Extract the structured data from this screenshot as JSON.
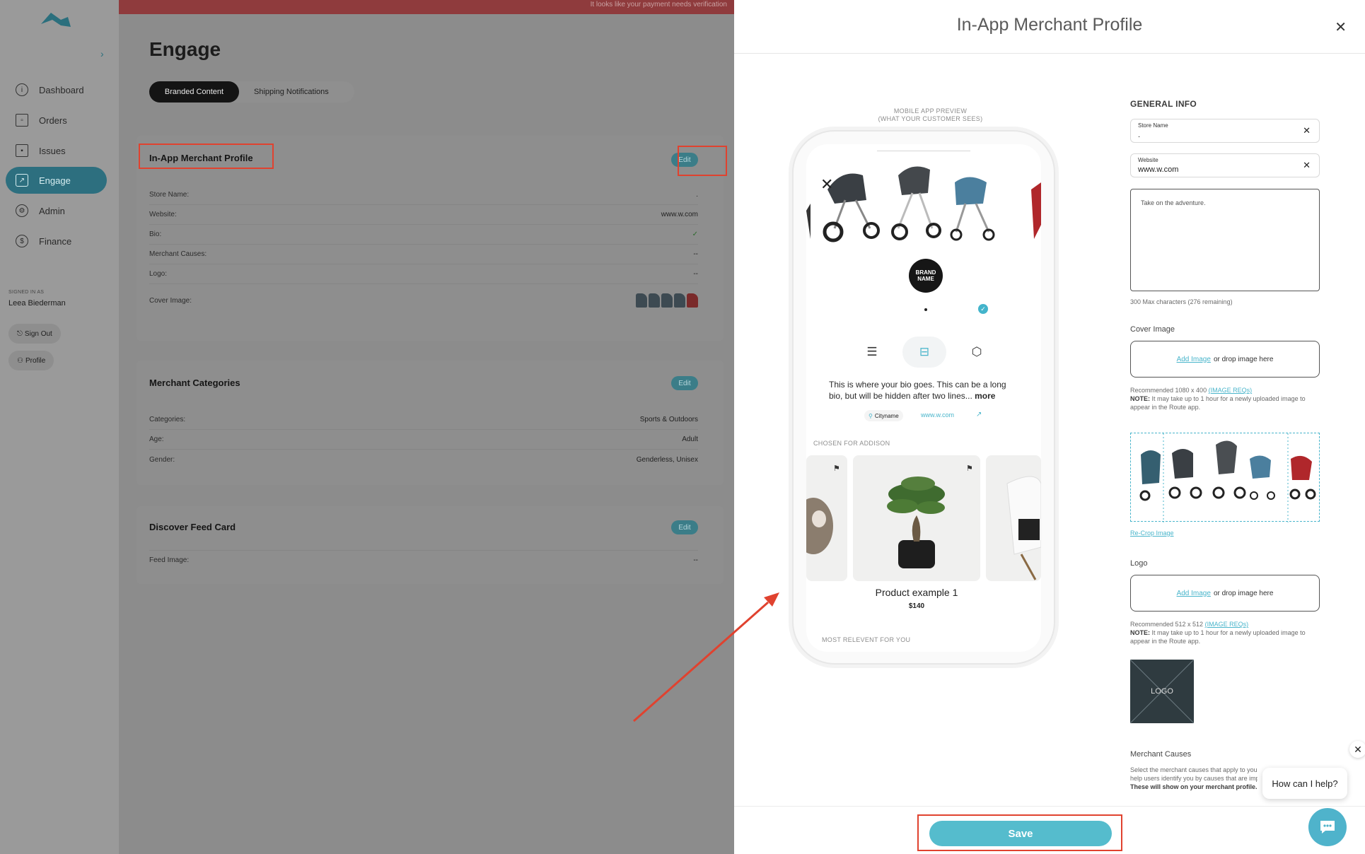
{
  "top_banner": "It looks like your payment needs verification",
  "sidebar": {
    "items": [
      {
        "label": "Dashboard",
        "icon": "info-icon"
      },
      {
        "label": "Orders",
        "icon": "cart-icon"
      },
      {
        "label": "Issues",
        "icon": "calendar-icon"
      },
      {
        "label": "Engage",
        "icon": "chart-icon"
      },
      {
        "label": "Admin",
        "icon": "gear-icon"
      },
      {
        "label": "Finance",
        "icon": "dollar-icon"
      }
    ],
    "signed_in_label": "SIGNED IN AS",
    "user_name": "Leea Biederman",
    "sign_out": "Sign Out",
    "profile": "Profile"
  },
  "main": {
    "title": "Engage",
    "tabs": [
      "Branded Content",
      "Shipping Notifications"
    ],
    "edit_label": "Edit",
    "merchant_profile": {
      "title": "In-App Merchant Profile",
      "rows": [
        {
          "label": "Store Name:",
          "value": "."
        },
        {
          "label": "Website:",
          "value": "www.w.com"
        },
        {
          "label": "Bio:",
          "value": "✓"
        },
        {
          "label": "Merchant Causes:",
          "value": "--"
        },
        {
          "label": "Logo:",
          "value": "--"
        },
        {
          "label": "Cover Image:",
          "value": ""
        }
      ]
    },
    "categories": {
      "title": "Merchant Categories",
      "rows": [
        {
          "label": "Categories:",
          "value": "Sports & Outdoors"
        },
        {
          "label": "Age:",
          "value": "Adult"
        },
        {
          "label": "Gender:",
          "value": "Genderless, Unisex"
        }
      ]
    },
    "feed_card": {
      "title": "Discover Feed Card",
      "rows": [
        {
          "label": "Feed Image:",
          "value": "--"
        }
      ]
    }
  },
  "panel": {
    "title": "In-App Merchant Profile",
    "preview_label_1": "MOBILE APP PREVIEW",
    "preview_label_2": "(WHAT YOUR CUSTOMER SEES)",
    "phone": {
      "brand": "BRAND NAME",
      "bio": "This is where your  bio goes. This can be a long bio, but will be hidden after two lines...",
      "more": "more",
      "city": "Cityname",
      "website": "www.w.com",
      "chosen_label": "CHOSEN FOR ADDISON",
      "product_name": "Product example 1",
      "product_price": "$140",
      "relevant_label": "MOST RELEVENT FOR YOU"
    },
    "form": {
      "general_info": "GENERAL INFO",
      "store_name_label": "Store Name",
      "store_name_value": ".",
      "website_label": "Website",
      "website_value": "www.w.com",
      "bio_placeholder": "Take on the adventure.",
      "bio_counter": "300 Max characters (276 remaining)",
      "cover_title": "Cover Image",
      "add_image": "Add Image",
      "drop_text": "or drop image here",
      "cover_rec": "Recommended 1080 x 400",
      "image_reqs": "(IMAGE REQs)",
      "note_label": "NOTE:",
      "note_text": "It may take up to 1 hour for a newly uploaded image to appear in the Route app.",
      "recrop": "Re-Crop Image",
      "logo_title": "Logo",
      "logo_rec": "Recommended 512 x 512",
      "logo_placeholder": "LOGO",
      "causes_title": "Merchant Causes",
      "causes_text": "Select the merchant causes that apply to your",
      "causes_text_2": "help users identify you by causes that are imp",
      "causes_bold": "These will show on your merchant profile."
    },
    "save": "Save"
  },
  "help": {
    "bubble": "How can I help?"
  },
  "colors": {
    "accent": "#55bccd",
    "highlight": "#e0422f",
    "nav_active": "#2d6f7f"
  }
}
